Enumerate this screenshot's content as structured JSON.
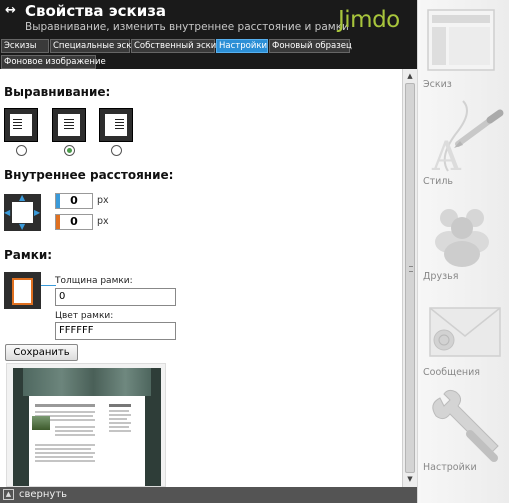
{
  "header": {
    "arrows": "↔",
    "title": "Свойства эскиза",
    "subtitle": "Выравнивание, изменить внутреннее расстояние и рамки",
    "logo": "Jimdo"
  },
  "tabs": [
    {
      "label": "Эскизы",
      "active": false
    },
    {
      "label": "Специальные эскизы",
      "active": false
    },
    {
      "label": "Собственный эскиз",
      "active": false
    },
    {
      "label": "Настройки",
      "active": true
    },
    {
      "label": "Фоновый образец",
      "active": false
    },
    {
      "label": "Фоновое изображение",
      "active": false
    }
  ],
  "alignment": {
    "heading": "Выравнивание:",
    "options": [
      "left",
      "center",
      "right"
    ],
    "selected": "center"
  },
  "padding": {
    "heading": "Внутреннее расстояние:",
    "top_value": "0",
    "bottom_value": "0",
    "unit": "px"
  },
  "border": {
    "heading": "Рамки:",
    "thickness_label": "Толщина рамки:",
    "thickness_value": "0",
    "color_label": "Цвет рамки:",
    "color_value": "FFFFFF"
  },
  "save_label": "Сохранить",
  "footer": {
    "collapse_label": "свернуть"
  },
  "sidebar": {
    "items": [
      {
        "label": "Эскиз",
        "icon": "sketch-icon"
      },
      {
        "label": "Стиль",
        "icon": "style-pen-icon"
      },
      {
        "label": "Друзья",
        "icon": "friends-icon"
      },
      {
        "label": "Сообщения",
        "icon": "messages-icon"
      },
      {
        "label": "Настройки",
        "icon": "settings-wrench-icon"
      }
    ]
  },
  "colors": {
    "accent_blue": "#2c8fd6",
    "accent_orange": "#e07020",
    "logo_green": "#a8c53c"
  }
}
